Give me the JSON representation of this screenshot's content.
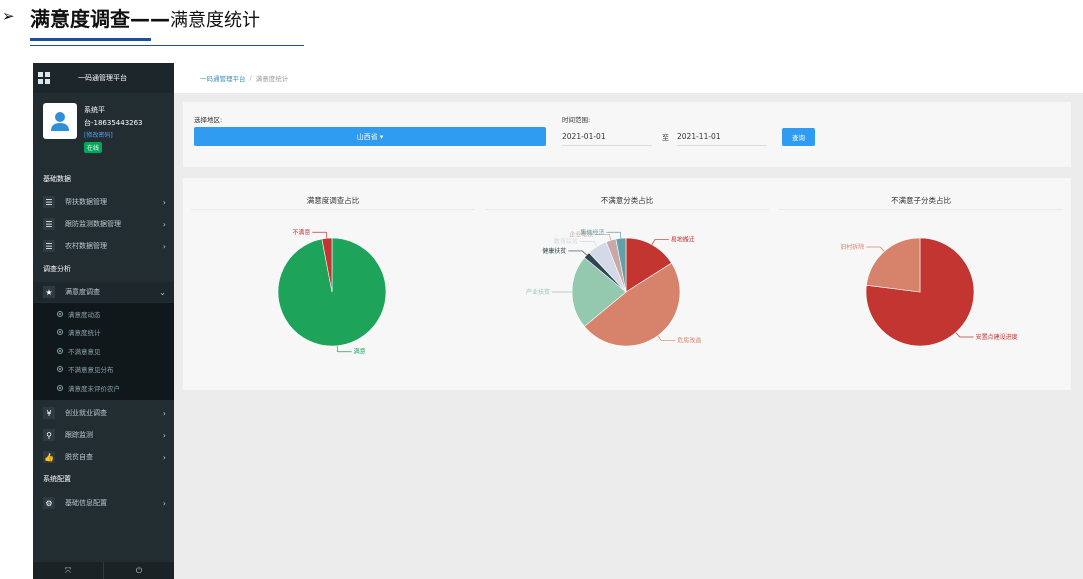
{
  "slide": {
    "arrow": "➢",
    "title_bold": "满意度调查——",
    "title_rest": "满意度统计"
  },
  "sidebar": {
    "brand": "一码通管理平台",
    "user": {
      "name": "系统平",
      "phone": "台-18635443263",
      "link": "[修改密码]",
      "status": "在线"
    },
    "sections": [
      "基础数据",
      "调查分析",
      "系统配置"
    ],
    "items": [
      {
        "label": "帮扶数据管理",
        "icon": "list-icon",
        "glyph": "☰"
      },
      {
        "label": "跟防监测数据管理",
        "icon": "list-icon",
        "glyph": "☰"
      },
      {
        "label": "农村数据管理",
        "icon": "list-icon",
        "glyph": "☰"
      },
      {
        "label": "满意度调查",
        "icon": "star-icon",
        "glyph": "★"
      },
      {
        "label": "创业就业调查",
        "icon": "yen-icon",
        "glyph": "¥"
      },
      {
        "label": "跟踪监测",
        "icon": "search-icon",
        "glyph": "⚲"
      },
      {
        "label": "脱贫自查",
        "icon": "thumb-icon",
        "glyph": "👍"
      },
      {
        "label": "基础信息配置",
        "icon": "gear-icon",
        "glyph": "⚙"
      }
    ],
    "subitems": [
      "满意度动态",
      "满意度统计",
      "不满意意见",
      "不满意意见分布",
      "满意度未评价农户"
    ],
    "bottom": [
      "⤧",
      "⏻"
    ]
  },
  "breadcrumb": {
    "home": "一码通管理平台",
    "sep": "/",
    "current": "满意度统计"
  },
  "filter": {
    "region_label": "选择地区:",
    "region_value": "山西省 ▾",
    "time_label": "时间范围:",
    "date_from": "2021-01-01",
    "to": "至",
    "date_to": "2021-11-01",
    "query": "查询"
  },
  "chart_data": [
    {
      "type": "pie",
      "title": "满意度调查占比",
      "labels": [
        "满意",
        "不满意"
      ],
      "values": [
        97,
        3
      ],
      "colors": [
        "#1ea35b",
        "#c23531"
      ]
    },
    {
      "type": "pie",
      "title": "不满意分类占比",
      "labels": [
        "易地搬迁",
        "危房改造",
        "产业扶贫",
        "健康扶贫",
        "教育扶贫",
        "企业帮扶",
        "集体经济"
      ],
      "values": [
        16,
        48,
        22,
        2,
        6,
        3,
        3
      ],
      "colors": [
        "#c23531",
        "#d7826a",
        "#94c9b0",
        "#2f4554",
        "#d3d9e6",
        "#c9a8a8",
        "#61a0a8"
      ]
    },
    {
      "type": "pie",
      "title": "不满意子分类占比",
      "labels": [
        "安置点建设进度",
        "旧村拆除"
      ],
      "values": [
        77,
        23
      ],
      "colors": [
        "#c23531",
        "#d7826a"
      ]
    }
  ]
}
